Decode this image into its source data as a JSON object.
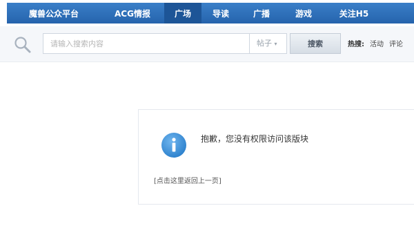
{
  "nav": {
    "items": [
      {
        "label": "魔兽公众平台",
        "active": false
      },
      {
        "label": "ACG情报",
        "active": false
      },
      {
        "label": "广场",
        "active": true
      },
      {
        "label": "导读",
        "active": false
      },
      {
        "label": "广播",
        "active": false
      },
      {
        "label": "游戏",
        "active": false
      },
      {
        "label": "关注H5",
        "active": false
      }
    ],
    "colors": {
      "bar": "#2c6db6",
      "active": "#1d5597",
      "text": "#ffffff"
    }
  },
  "search": {
    "icon": "search-icon",
    "placeholder": "请输入搜索内容",
    "type_label": "帖子",
    "type_chevron": "chevron-down-icon",
    "button_label": "搜索",
    "hot_label": "热搜:",
    "hot_links": [
      "活动",
      "评论"
    ]
  },
  "message": {
    "icon": "info-icon",
    "icon_color": "#3a8fd6",
    "text": "抱歉，您没有权限访问该版块",
    "back_link": "[点击这里返回上一页]"
  }
}
